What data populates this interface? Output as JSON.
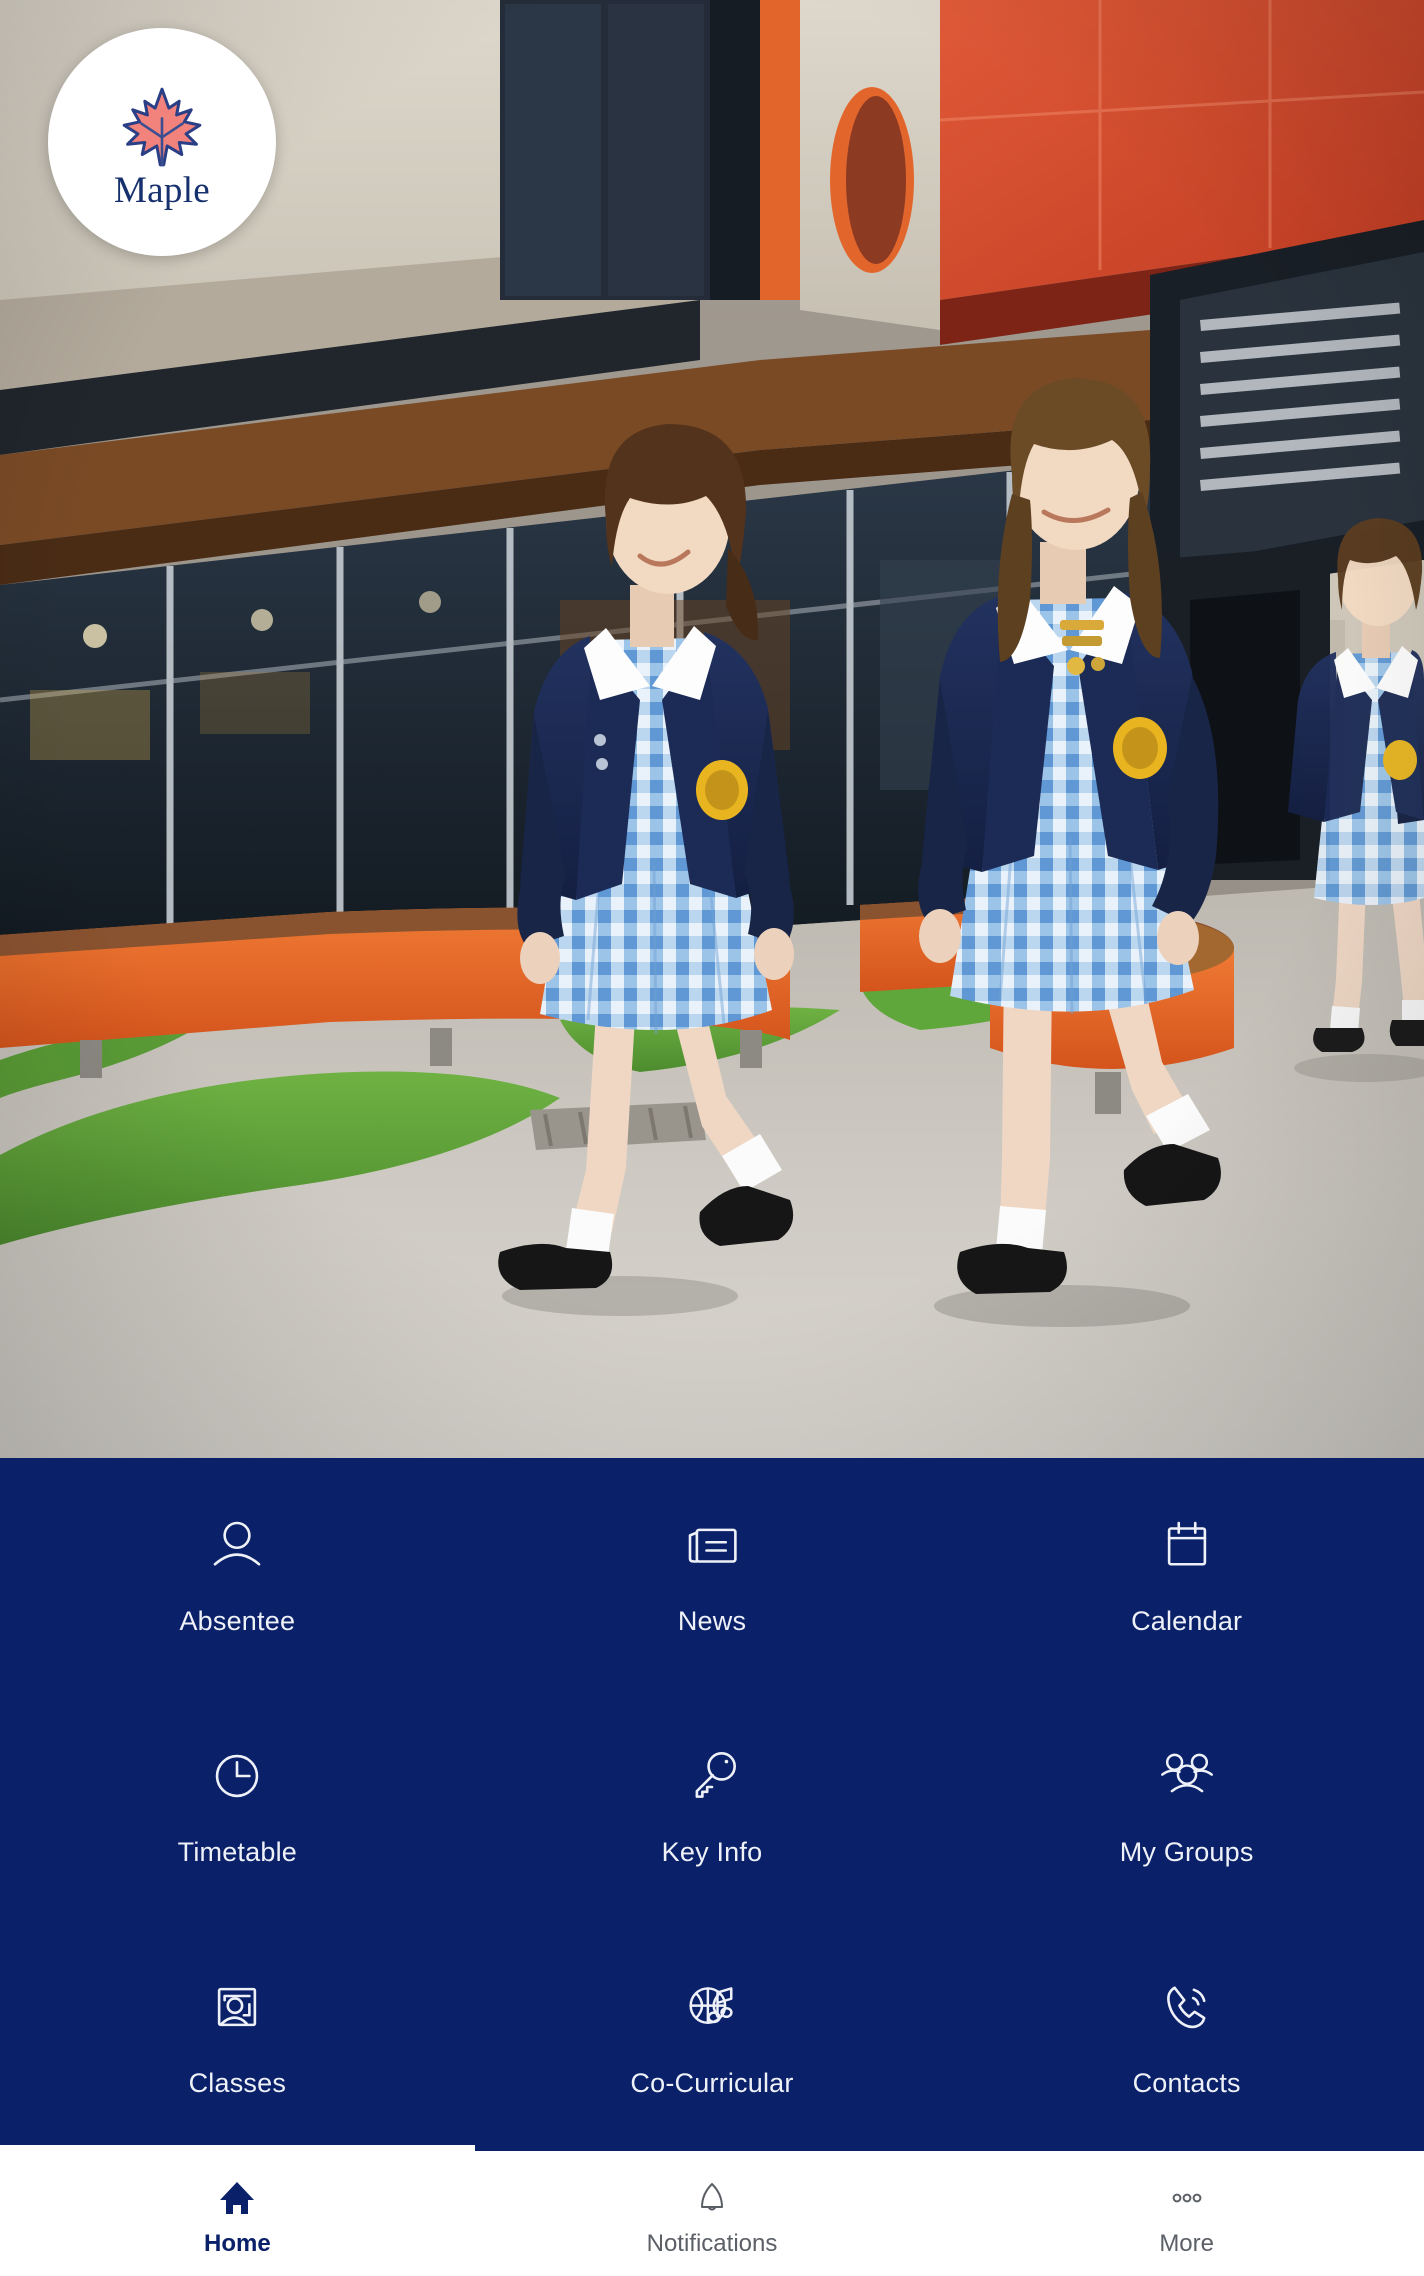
{
  "brand": {
    "name": "Maple",
    "logo_icon": "maple-leaf-icon",
    "leaf_fill": "#f2827c",
    "leaf_stroke": "#2b3f86",
    "text_color": "#17306e"
  },
  "theme": {
    "navy": "#0a2068",
    "panel_text": "#eef1f8",
    "tabbar_bg": "#ffffff",
    "tab_active": "#0a2068",
    "tab_inactive": "#5b5f66"
  },
  "hero": {
    "alt": "Two schoolgirls in navy blazers and blue gingham dresses walking through a modern school courtyard",
    "colors": {
      "paving": "#cfcbc4",
      "turf": "#5ba13a",
      "bench_orange": "#e8662a",
      "facade_cream": "#d8d2c6",
      "facade_red": "#d8452c",
      "glass_dark": "#1d2733",
      "blazer_navy": "#1b2a56",
      "gingham_blue": "#7fb0e0"
    }
  },
  "grid": {
    "tiles": [
      {
        "label": "Absentee",
        "icon": "person-icon"
      },
      {
        "label": "News",
        "icon": "newspaper-icon"
      },
      {
        "label": "Calendar",
        "icon": "calendar-icon"
      },
      {
        "label": "Timetable",
        "icon": "clock-icon"
      },
      {
        "label": "Key Info",
        "icon": "key-icon"
      },
      {
        "label": "My Groups",
        "icon": "people-group-icon"
      },
      {
        "label": "Classes",
        "icon": "classroom-frame-icon"
      },
      {
        "label": "Co-Curricular",
        "icon": "basketball-music-note-icon"
      },
      {
        "label": "Contacts",
        "icon": "phone-call-icon"
      }
    ]
  },
  "tabbar": {
    "tabs": [
      {
        "label": "Home",
        "icon": "home-icon",
        "active": true
      },
      {
        "label": "Notifications",
        "icon": "bell-icon",
        "active": false
      },
      {
        "label": "More",
        "icon": "ellipsis-icon",
        "active": false
      }
    ]
  }
}
